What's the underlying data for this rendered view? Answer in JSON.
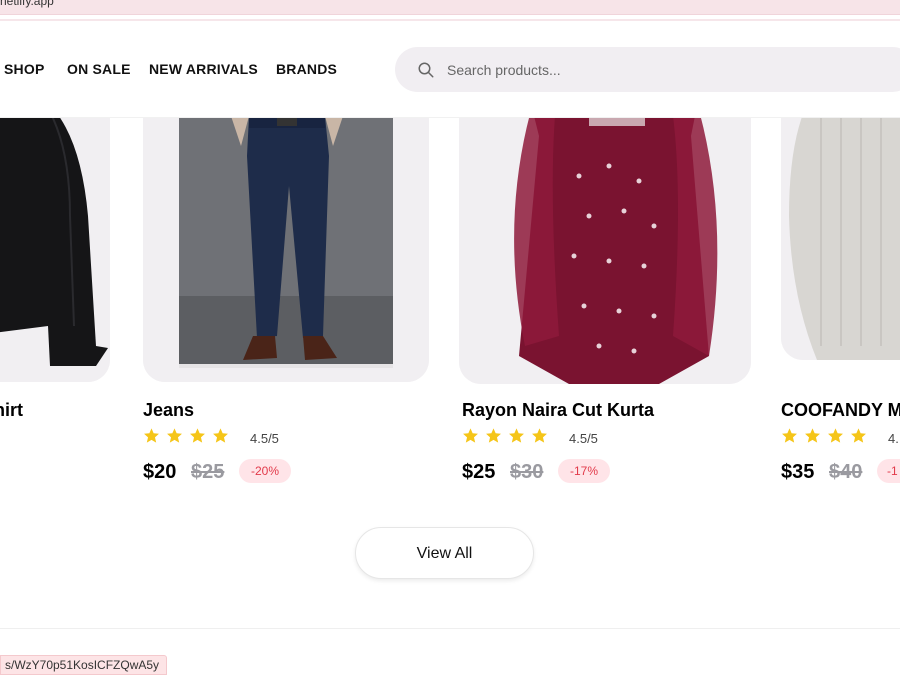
{
  "browser": {
    "url_fragment": "netlify.app",
    "status_url": "s/WzY70p51KosICFZQwA5y"
  },
  "nav": {
    "items": [
      "SHOP",
      "ON SALE",
      "NEW ARRIVALS",
      "BRANDS"
    ],
    "search_placeholder": "Search products..."
  },
  "products": [
    {
      "title": "hirt"
    },
    {
      "title": "Jeans",
      "rating": "4.5/5",
      "stars": 4.5,
      "price": "$20",
      "old_price": "$25",
      "discount": "-20%"
    },
    {
      "title": "Rayon Naira Cut Kurta",
      "rating": "4.5/5",
      "stars": 4.5,
      "price": "$25",
      "old_price": "$30",
      "discount": "-17%"
    },
    {
      "title": "COOFANDY M",
      "rating": "4.",
      "stars": 4.5,
      "price": "$35",
      "old_price": "$40",
      "discount": "-1"
    }
  ],
  "view_all_label": "View All",
  "colors": {
    "star": "#f5c518",
    "badge_bg": "#ffe4e8",
    "badge_text": "#e23a4a"
  }
}
